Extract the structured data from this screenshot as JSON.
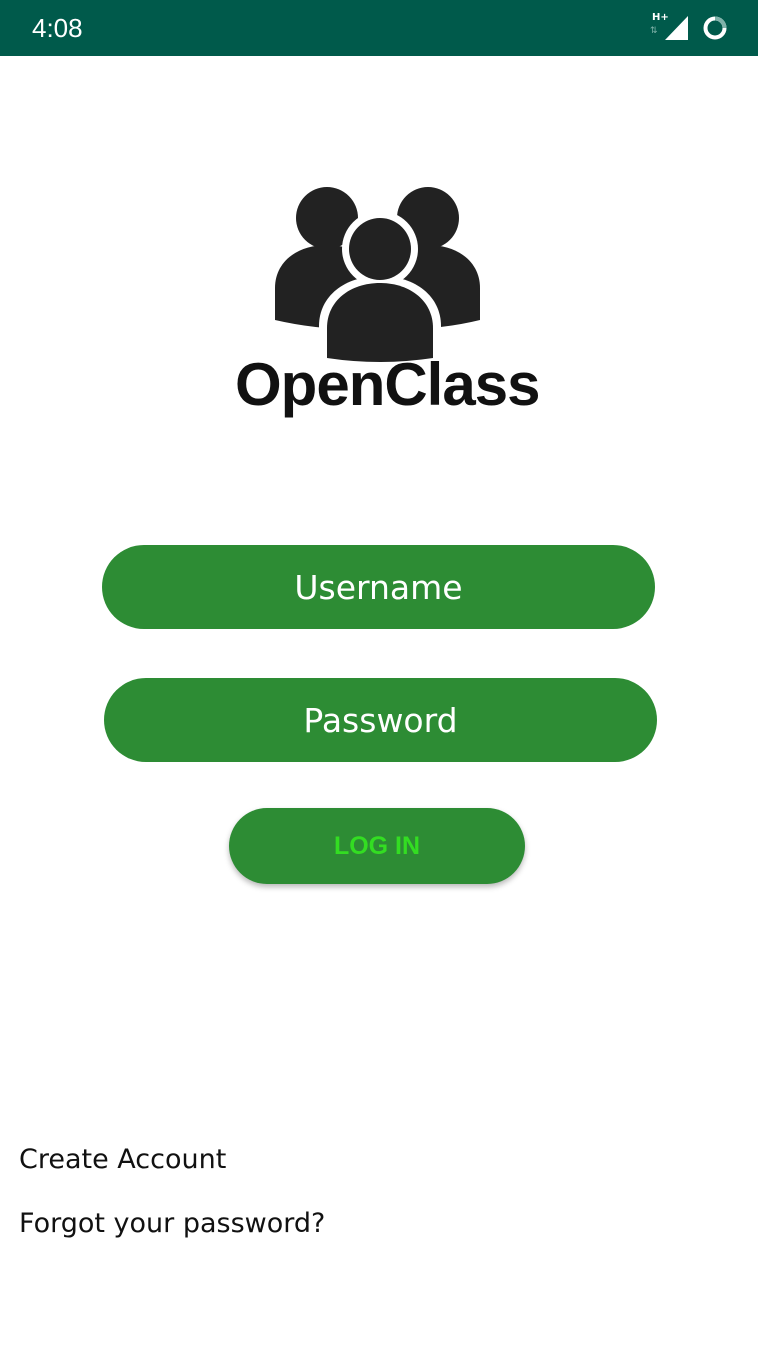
{
  "status_bar": {
    "time": "4:08",
    "network_type": "H+",
    "icons": [
      "network-type-icon",
      "signal-icon",
      "loading-ring-icon"
    ],
    "color": "#005a4b"
  },
  "logo": {
    "text": "OpenClass",
    "icon": "people-group-icon"
  },
  "form": {
    "username_placeholder": "Username",
    "password_placeholder": "Password",
    "login_label": "LOG IN"
  },
  "links": {
    "create_account": "Create Account",
    "forgot_password": "Forgot your password?"
  },
  "colors": {
    "accent": "#2d8c34",
    "login_text": "#33dd22"
  }
}
